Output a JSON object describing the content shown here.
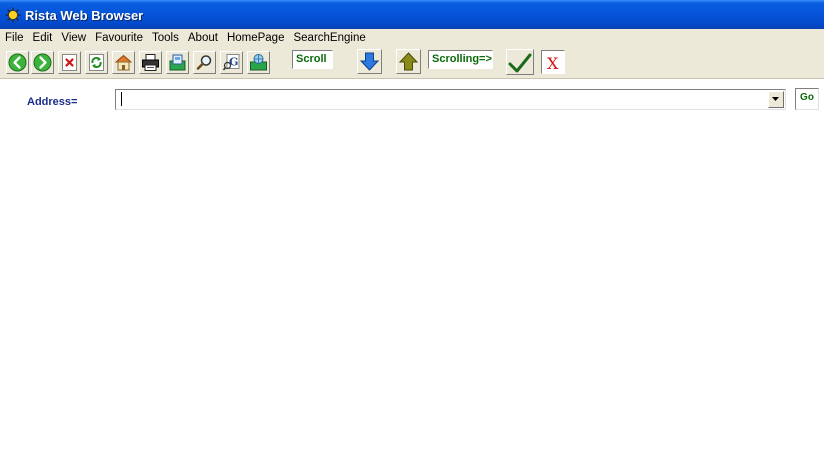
{
  "window": {
    "title": "Rista Web Browser"
  },
  "menu": [
    "File",
    "Edit",
    "View",
    "Favourite",
    "Tools",
    "About",
    "HomePage",
    "SearchEngine"
  ],
  "toolbar": {
    "scroll_label": "Scroll",
    "scrolling_label": "Scrolling=>"
  },
  "address": {
    "label": "Address=",
    "value": "",
    "go_label": "Go"
  },
  "colors": {
    "titlebar": "#0553d8",
    "chrome": "#ece9d8",
    "label_green": "#0b6b0b",
    "address_label": "#1b2e8a"
  }
}
